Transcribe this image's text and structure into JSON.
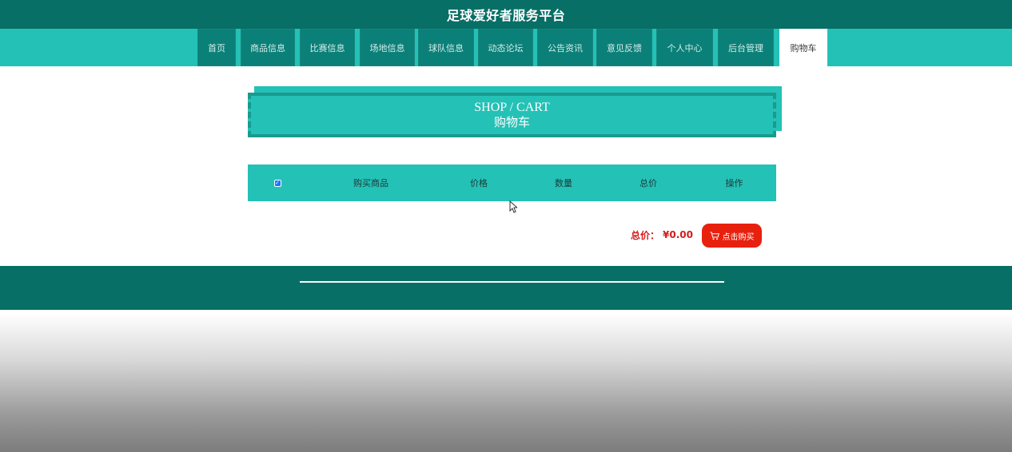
{
  "header": {
    "title": "足球爱好者服务平台"
  },
  "nav": {
    "items": [
      {
        "label": "首页"
      },
      {
        "label": "商品信息"
      },
      {
        "label": "比赛信息"
      },
      {
        "label": "场地信息"
      },
      {
        "label": "球队信息"
      },
      {
        "label": "动态论坛"
      },
      {
        "label": "公告资讯"
      },
      {
        "label": "意见反馈"
      },
      {
        "label": "个人中心"
      },
      {
        "label": "后台管理"
      },
      {
        "label": "购物车"
      }
    ],
    "active_label": "购物车"
  },
  "cart": {
    "title_en": "SHOP / CART",
    "title_cn": "购物车",
    "select_all_checked": true,
    "columns": [
      "购买商品",
      "价格",
      "数量",
      "总价",
      "操作"
    ],
    "rows": []
  },
  "summary": {
    "total_label": "总价：",
    "total_value": "¥0.00",
    "buy_label": "点击购买"
  },
  "colors": {
    "primary_dark": "#076f66",
    "primary": "#24c1b6",
    "nav_item": "#0b8078",
    "danger": "#e8210e"
  },
  "icons": {
    "cart": "shopping-cart-icon",
    "checkbox": "checkbox-checked-icon"
  }
}
